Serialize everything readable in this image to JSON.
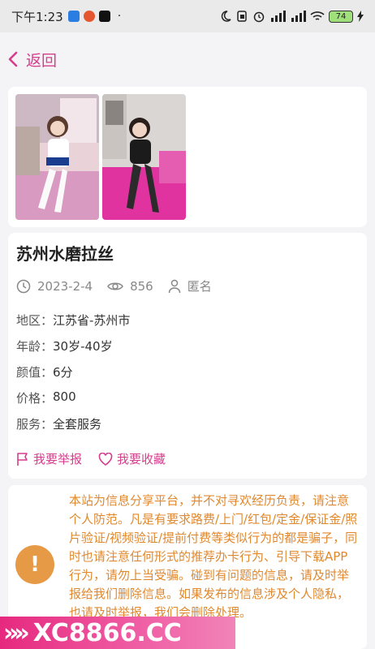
{
  "status_bar": {
    "time": "下午1:23",
    "dot": "·",
    "battery": "74"
  },
  "nav": {
    "back_label": "返回"
  },
  "post": {
    "title": "苏州水磨拉丝",
    "date": "2023-2-4",
    "views": "856",
    "author": "匿名",
    "fields": [
      {
        "label": "地区：",
        "value": "江苏省-苏州市"
      },
      {
        "label": "年龄：",
        "value": "30岁-40岁"
      },
      {
        "label": "颜值：",
        "value": "6分"
      },
      {
        "label": "价格：",
        "value": "800"
      },
      {
        "label": "服务：",
        "value": "全套服务"
      }
    ],
    "report_label": "我要举报",
    "favorite_label": "我要收藏"
  },
  "notice": {
    "icon": "!",
    "text": "本站为信息分享平台，并不对寻欢经历负责，请注意个人防范。凡是有要求路费/上门/红包/定金/保证金/照片验证/视频验证/提前付费等类似行为的都是骗子，同时也请注意任何形式的推荐办卡行为、引导下载APP行为，请勿上当受骗。碰到有问题的信息，请及时举报给我们删除信息。如果发布的信息涉及个人隐私，也请及时举报，我们会删除处理。"
  },
  "watermark": {
    "chevrons": "»»",
    "text": "XC8866.CC"
  },
  "colors": {
    "accent": "#d63d8c",
    "notice": "#e0892f",
    "notice_icon": "#e69a45"
  },
  "icons": [
    "back-chevron-icon",
    "clock-icon",
    "eye-icon",
    "user-icon",
    "flag-icon",
    "heart-icon",
    "moon-icon",
    "alarm-icon",
    "signal-icon",
    "wifi-icon"
  ]
}
